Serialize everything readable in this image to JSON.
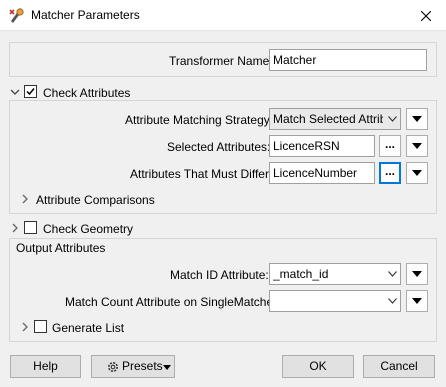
{
  "window": {
    "title": "Matcher Parameters",
    "icon": "fme-transformer-icon"
  },
  "transformer_name": {
    "label": "Transformer Name:",
    "value": "Matcher"
  },
  "check_attributes": {
    "label": "Check Attributes",
    "checked": true,
    "matching_strategy": {
      "label": "Attribute Matching Strategy:",
      "value": "Match Selected Attributes",
      "display": "Match Selected Attribu"
    },
    "selected_attributes": {
      "label": "Selected Attributes:",
      "value": "LicenceRSN",
      "button": "..."
    },
    "must_differ": {
      "label": "Attributes That Must Differ:",
      "value": "LicenceNumber",
      "button": "..."
    },
    "comparisons": {
      "label": "Attribute Comparisons"
    }
  },
  "check_geometry": {
    "label": "Check Geometry",
    "checked": false
  },
  "output_attributes": {
    "label": "Output Attributes",
    "match_id": {
      "label": "Match ID Attribute:",
      "value": "_match_id"
    },
    "match_count": {
      "label": "Match Count Attribute on SingleMatched:",
      "value": ""
    },
    "generate_list": {
      "label": "Generate List",
      "checked": false
    }
  },
  "footer": {
    "help": "Help",
    "presets": "Presets",
    "ok": "OK",
    "cancel": "Cancel"
  }
}
